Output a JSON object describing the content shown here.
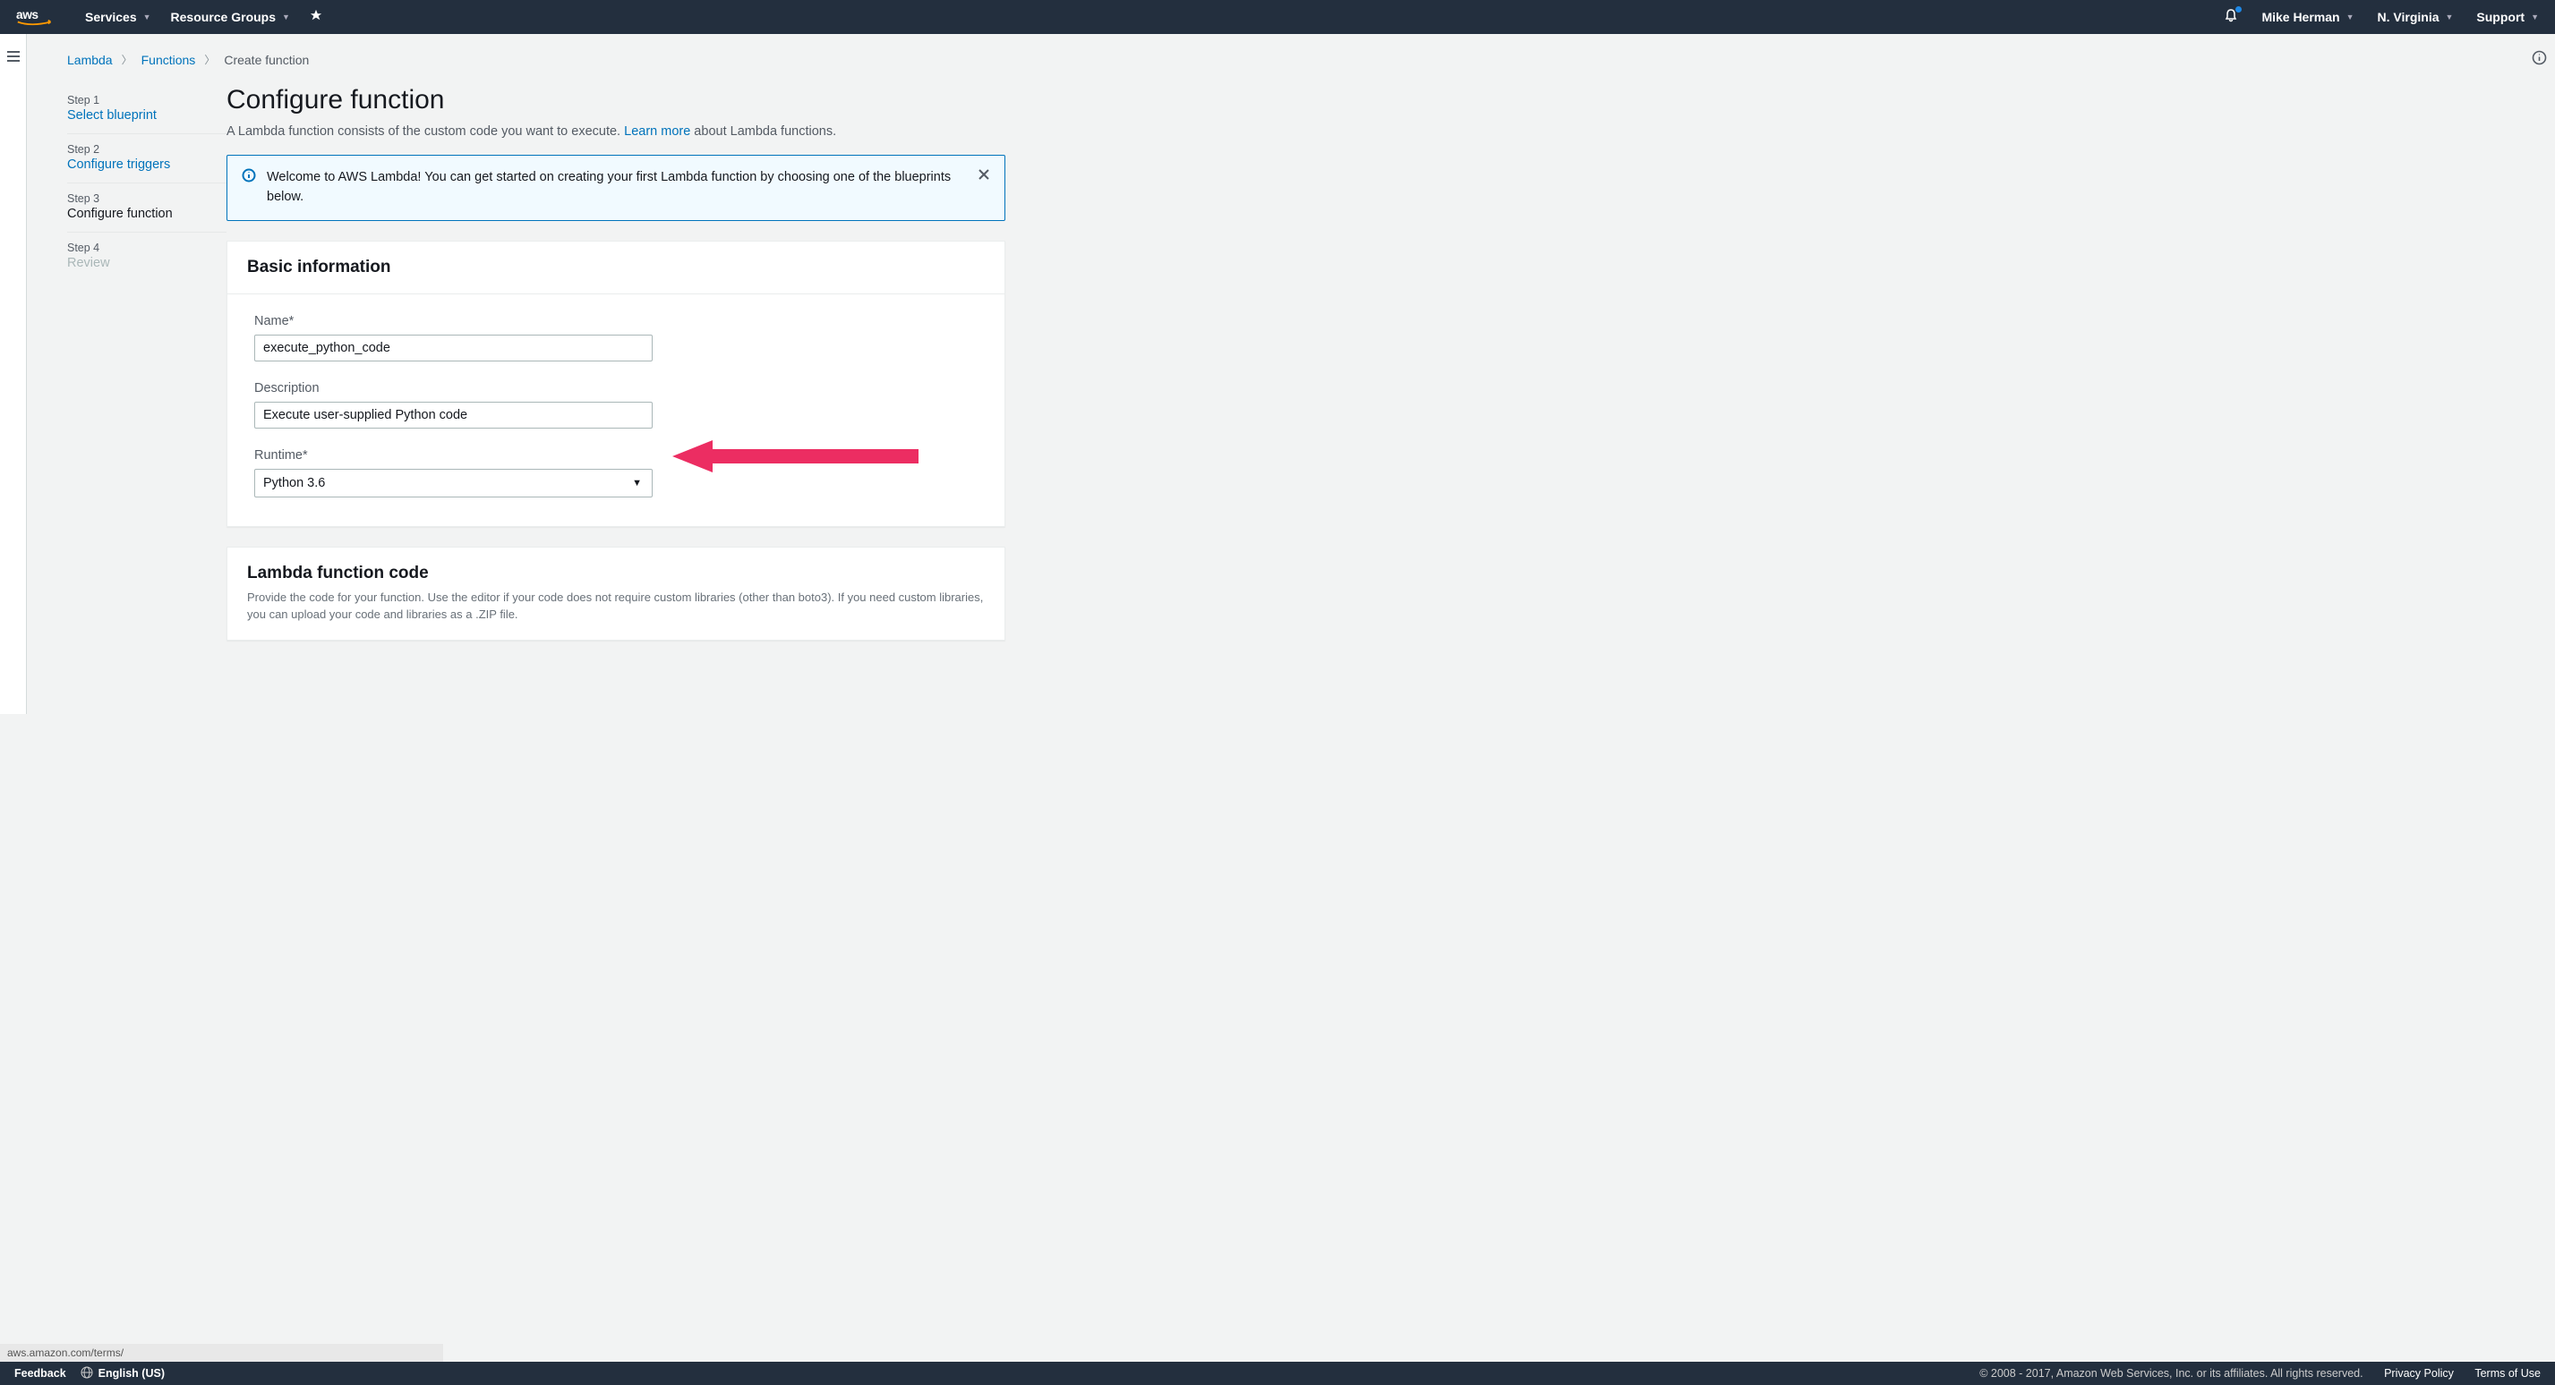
{
  "nav": {
    "services": "Services",
    "resource_groups": "Resource Groups",
    "user": "Mike Herman",
    "region": "N. Virginia",
    "support": "Support"
  },
  "breadcrumbs": {
    "lambda": "Lambda",
    "functions": "Functions",
    "create": "Create function"
  },
  "steps": {
    "s1_label": "Step 1",
    "s1_title": "Select blueprint",
    "s2_label": "Step 2",
    "s2_title": "Configure triggers",
    "s3_label": "Step 3",
    "s3_title": "Configure function",
    "s4_label": "Step 4",
    "s4_title": "Review"
  },
  "page": {
    "title": "Configure function",
    "sub_pre": "A Lambda function consists of the custom code you want to execute. ",
    "learn": "Learn more",
    "sub_post": " about Lambda functions."
  },
  "alert": {
    "text": "Welcome to AWS Lambda! You can get started on creating your first Lambda function by choosing one of the blueprints below."
  },
  "basic": {
    "heading": "Basic information",
    "name_label": "Name*",
    "name_value": "execute_python_code",
    "desc_label": "Description",
    "desc_value": "Execute user-supplied Python code",
    "runtime_label": "Runtime*",
    "runtime_value": "Python 3.6"
  },
  "code": {
    "heading": "Lambda function code",
    "subtext": "Provide the code for your function. Use the editor if your code does not require custom libraries (other than boto3). If you need custom libraries, you can upload your code and libraries as a .ZIP file."
  },
  "footer": {
    "feedback": "Feedback",
    "lang": "English (US)",
    "copyright": "© 2008 - 2017, Amazon Web Services, Inc. or its affiliates. All rights reserved.",
    "privacy": "Privacy Policy",
    "terms": "Terms of Use",
    "url": "aws.amazon.com/terms/"
  }
}
